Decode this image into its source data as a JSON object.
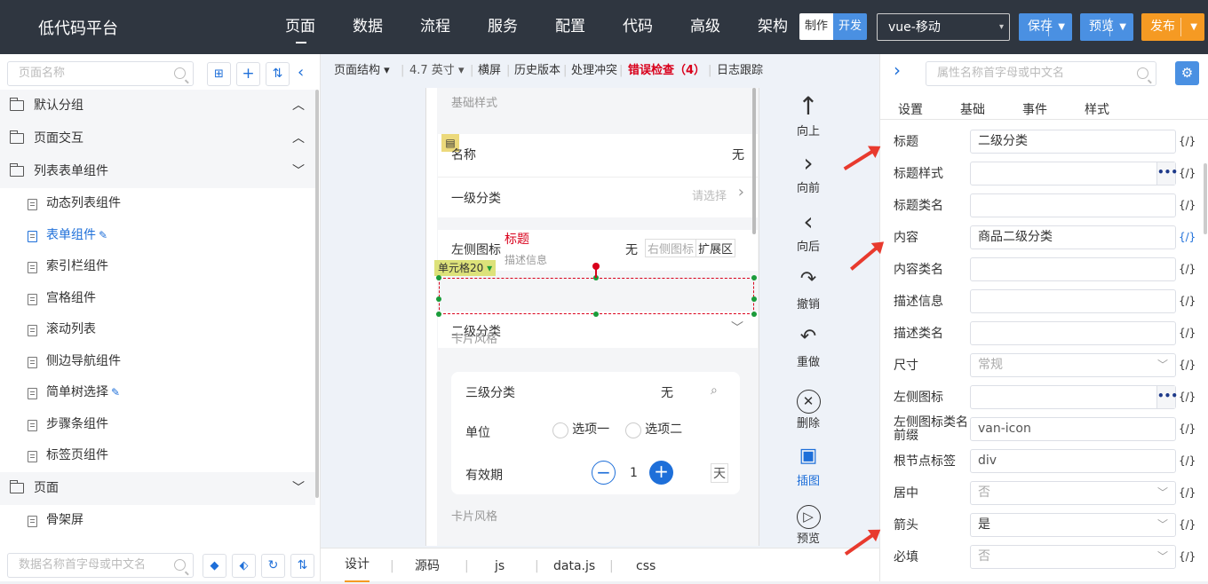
{
  "app": {
    "title": "低代码平台"
  },
  "nav": [
    "页面",
    "数据",
    "流程",
    "服务",
    "配置",
    "代码",
    "高级",
    "架构"
  ],
  "mode": {
    "make": "制作",
    "dev": "开发"
  },
  "device": "vue-移动",
  "buttons": {
    "save": "保存",
    "preview": "预览",
    "publish": "发布"
  },
  "left": {
    "search_placeholder": "页面名称",
    "bottom_placeholder": "数据名称首字母或中文名",
    "groups": {
      "g1": "默认分组",
      "g2": "页面交互",
      "g3": "列表表单组件",
      "g4": "页面"
    },
    "items": [
      "动态列表组件",
      "表单组件",
      "索引栏组件",
      "宫格组件",
      "滚动列表",
      "侧边导航组件",
      "简单树选择",
      "步骤条组件",
      "标签页组件"
    ],
    "page_item": "骨架屏"
  },
  "toolbar": {
    "structure": "页面结构",
    "size": "4.7 英寸",
    "landscape": "横屏",
    "history": "历史版本",
    "conflict": "处理冲突",
    "errors": "错误检查（4）",
    "log": "日志跟踪"
  },
  "phone": {
    "basic_style": "基础样式",
    "name_label": "名称",
    "name_value": "无",
    "cat1_label": "一级分类",
    "cat1_placeholder": "请选择",
    "left_icon_label": "左侧图标",
    "title_red": "标题",
    "desc": "描述信息",
    "left_icon_value": "无",
    "right_icon": "右侧图标",
    "extend": "扩展区",
    "cell_tag": "单元格20",
    "cat2_label": "二级分类",
    "card_style": "卡片风格",
    "cat3_label": "三级分类",
    "cat3_value": "无",
    "unit_label": "单位",
    "option1": "选项一",
    "option2": "选项二",
    "validity_label": "有效期",
    "validity_value": "1",
    "day": "天",
    "card_style2": "卡片风格"
  },
  "actions": [
    "向上",
    "向前",
    "向后",
    "撤销",
    "重做",
    "删除",
    "插图",
    "预览"
  ],
  "bottom_tabs": [
    "设计",
    "源码",
    "js",
    "data.js",
    "css"
  ],
  "right": {
    "search_placeholder": "属性名称首字母或中文名",
    "tabs": [
      "设置",
      "基础",
      "事件",
      "样式"
    ],
    "code_token": "{/}",
    "props": [
      {
        "label": "标题",
        "value": "二级分类"
      },
      {
        "label": "标题样式",
        "value": ""
      },
      {
        "label": "标题类名",
        "value": ""
      },
      {
        "label": "内容",
        "value": "商品二级分类"
      },
      {
        "label": "内容类名",
        "value": ""
      },
      {
        "label": "描述信息",
        "value": ""
      },
      {
        "label": "描述类名",
        "value": ""
      },
      {
        "label": "尺寸",
        "value": "常规"
      },
      {
        "label": "左侧图标",
        "value": ""
      },
      {
        "label": "左侧图标类名前缀",
        "value": "van-icon"
      },
      {
        "label": "根节点标签",
        "value": "div"
      },
      {
        "label": "居中",
        "value": "否"
      },
      {
        "label": "箭头",
        "value": "是"
      },
      {
        "label": "必填",
        "value": "否"
      }
    ]
  },
  "colors": {
    "topbar": "#2f3640",
    "accent": "#4a90e2",
    "publish": "#f59a23",
    "error": "#d9001b"
  }
}
